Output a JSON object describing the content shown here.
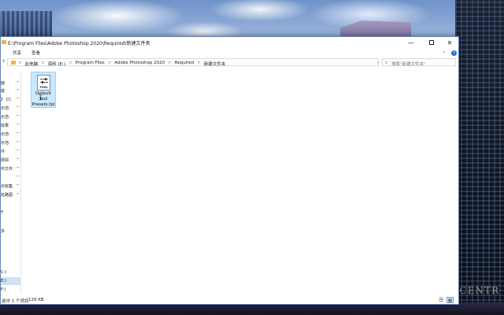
{
  "window": {
    "title": "E:\\Program Files\\Adobe Photoshop 2020\\Required\\新建文件夹",
    "title_short": "E:\\Program Files\\Adobe Photoshop 2020\\Required\\新建文件夹"
  },
  "ribbon": {
    "tabs": [
      "共享",
      "查看"
    ]
  },
  "address": {
    "crumbs": [
      "此电脑",
      "资料 (E:)",
      "Program Files",
      "Adobe Photoshop 2020",
      "Required",
      "新建文件夹"
    ],
    "separator": ">"
  },
  "search": {
    "placeholder": "搜索\"新建文件夹\""
  },
  "navpane": {
    "items": [
      {
        "label": "",
        "pinned": false
      },
      {
        "label": "面",
        "pinned": true
      },
      {
        "label": "载",
        "pinned": true
      },
      {
        "label": "】 CC",
        "pinned": true
      },
      {
        "label": "示范·",
        "pinned": true
      },
      {
        "label": "示范·",
        "pinned": true
      },
      {
        "label": "效果",
        "pinned": true
      },
      {
        "label": "示范·",
        "pinned": true
      },
      {
        "label": "示范·",
        "pinned": true
      },
      {
        "label": "件",
        "pinned": true
      },
      {
        "label": "网领",
        "pinned": true
      },
      {
        "label": "作文件",
        "pinned": true
      },
      {
        "label": "",
        "pinned": true
      },
      {
        "label": "示收集",
        "pinned": true
      },
      {
        "label": "处路图",
        "pinned": true
      },
      {
        "label": "",
        "pinned": false
      },
      {
        "label": "e",
        "pinned": false
      },
      {
        "label": "",
        "pinned": false
      },
      {
        "label": "多",
        "pinned": false
      }
    ],
    "bottom_items": [
      {
        "label": "C:)",
        "selected": false
      },
      {
        "label": "E:)",
        "selected": true
      },
      {
        "label": "F:)",
        "selected": false
      }
    ]
  },
  "file": {
    "name_line1": "Default",
    "name_line2": "Tool",
    "name_line3": "Presets.tpl",
    "icon_tag": "TOOL"
  },
  "status": {
    "count": "1 个项目",
    "count_prefix": "个项目",
    "selection": "选中 1 个项目",
    "size": "129 KB"
  },
  "desktop": {
    "sign": "CENTR"
  },
  "icons": [
    "folder-icon",
    "minimize-icon",
    "maximize-icon",
    "close-icon",
    "chevron-down-icon",
    "help-icon",
    "up-arrow-icon",
    "refresh-icon",
    "search-icon",
    "pin-icon",
    "tool-preset-file-icon",
    "details-view-icon",
    "large-icons-view-icon",
    "mouse-cursor-icon"
  ],
  "colors": {
    "selection": "#cce8ff",
    "selection_border": "#99d1ff",
    "folder": "#e8b73a",
    "help": "#1e6fd9"
  }
}
